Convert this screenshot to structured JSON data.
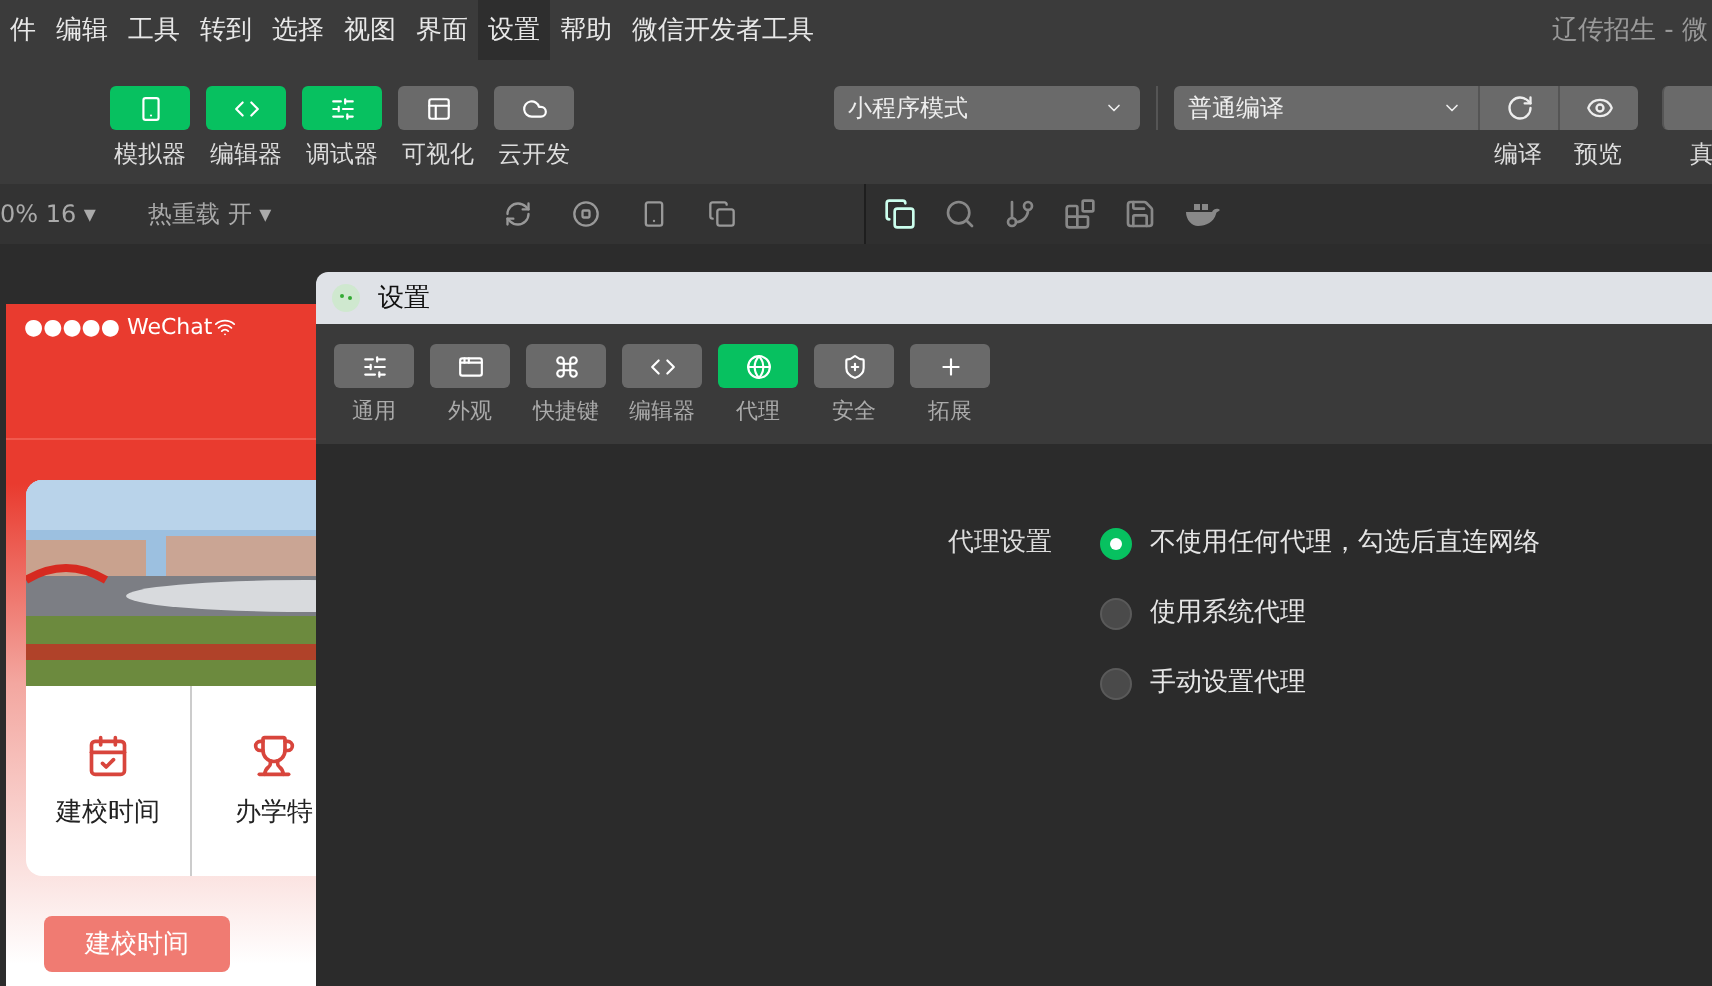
{
  "menu_bar": {
    "items": [
      {
        "label": "件",
        "selected": false
      },
      {
        "label": "编辑",
        "selected": false
      },
      {
        "label": "工具",
        "selected": false
      },
      {
        "label": "转到",
        "selected": false
      },
      {
        "label": "选择",
        "selected": false
      },
      {
        "label": "视图",
        "selected": false
      },
      {
        "label": "界面",
        "selected": false
      },
      {
        "label": "设置",
        "selected": true
      },
      {
        "label": "帮助",
        "selected": false
      },
      {
        "label": "微信开发者工具",
        "selected": false
      }
    ],
    "title": "辽传招生 - 微"
  },
  "toolbar": {
    "view_buttons": [
      {
        "label": "模拟器",
        "active": true
      },
      {
        "label": "编辑器",
        "active": true
      },
      {
        "label": "调试器",
        "active": true
      },
      {
        "label": "可视化",
        "active": false
      },
      {
        "label": "云开发",
        "active": false
      }
    ],
    "mode_select": "小程序模式",
    "compile_select": "普通编译",
    "action_buttons": [
      {
        "label": "编译"
      },
      {
        "label": "预览"
      },
      {
        "label": "真"
      }
    ]
  },
  "sub_bar": {
    "zoom": "0% 16 ▾",
    "hot_reload": "热重载 开 ▾"
  },
  "simulator": {
    "status": "●●●●● WeChat",
    "features": [
      {
        "label": "建校时间"
      },
      {
        "label": "办学特"
      }
    ],
    "buttons": [
      "建校时间"
    ]
  },
  "settings_dialog": {
    "title": "设置",
    "tabs": [
      {
        "label": "通用",
        "selected": false
      },
      {
        "label": "外观",
        "selected": false
      },
      {
        "label": "快捷键",
        "selected": false
      },
      {
        "label": "编辑器",
        "selected": false
      },
      {
        "label": "代理",
        "selected": true
      },
      {
        "label": "安全",
        "selected": false
      },
      {
        "label": "拓展",
        "selected": false
      }
    ],
    "proxy": {
      "label": "代理设置",
      "options": [
        {
          "label": "不使用任何代理，勾选后直连网络",
          "selected": true
        },
        {
          "label": "使用系统代理",
          "selected": false
        },
        {
          "label": "手动设置代理",
          "selected": false
        }
      ]
    }
  }
}
